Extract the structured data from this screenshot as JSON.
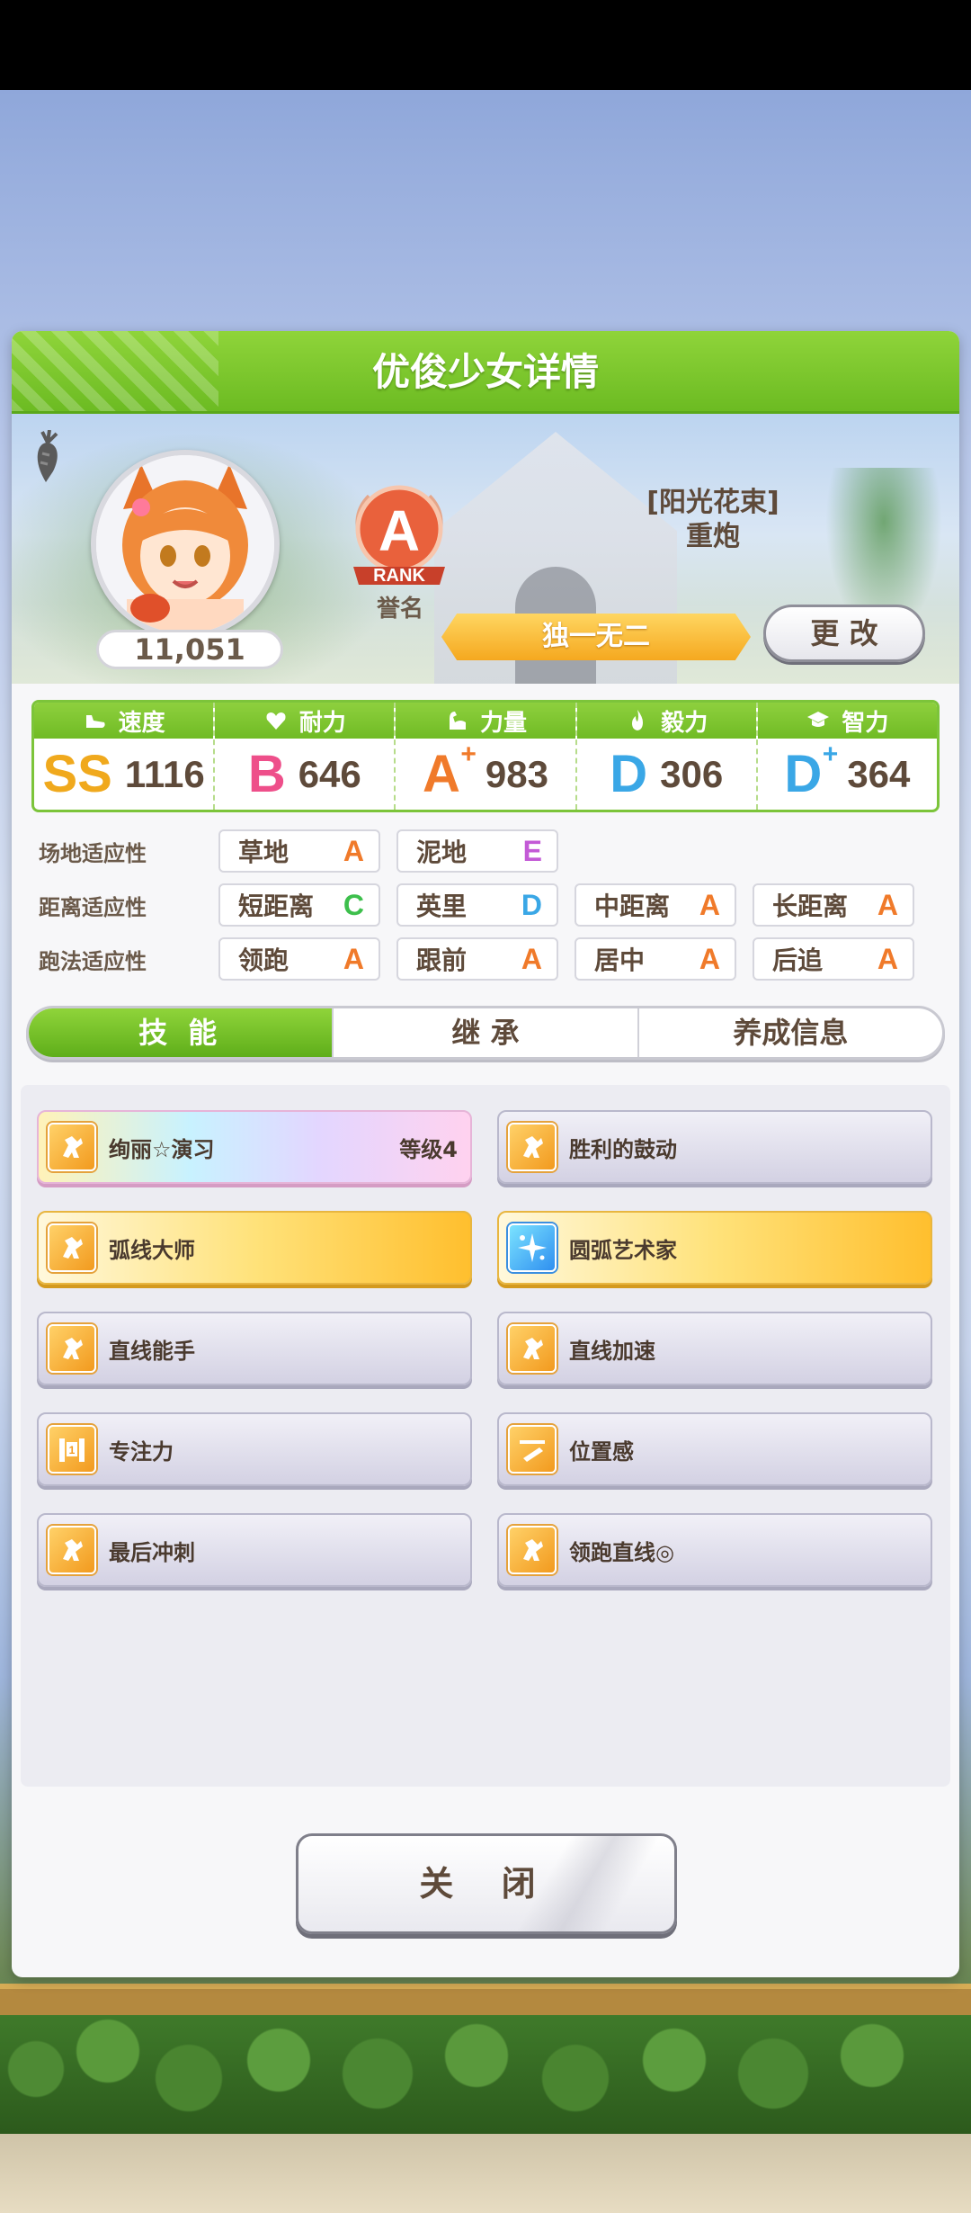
{
  "dialog": {
    "title": "优俊少女详情",
    "close_label": "关 闭"
  },
  "profile": {
    "fan_count": "11,051",
    "rank_grade": "A",
    "rank_word": "RANK",
    "rank_title": "誉名",
    "epithet_line1": "[阳光花束]",
    "epithet_line2": "重炮",
    "unique_banner": "独一无二",
    "change_label": "更 改"
  },
  "stats": [
    {
      "label": "速度",
      "icon": "shoe-icon",
      "grade": "SS",
      "plus": "",
      "value": "1116",
      "color": "#f0a91d"
    },
    {
      "label": "耐力",
      "icon": "heart-icon",
      "grade": "B",
      "plus": "",
      "value": "646",
      "color": "#ee4f8a"
    },
    {
      "label": "力量",
      "icon": "arm-icon",
      "grade": "A",
      "plus": "+",
      "value": "983",
      "color": "#f07a2a"
    },
    {
      "label": "毅力",
      "icon": "flame-icon",
      "grade": "D",
      "plus": "",
      "value": "306",
      "color": "#3aa7e6"
    },
    {
      "label": "智力",
      "icon": "mortarboard-icon",
      "grade": "D",
      "plus": "+",
      "value": "364",
      "color": "#3aa7e6"
    }
  ],
  "aptitude": {
    "track_label": "场地适应性",
    "track": [
      {
        "name": "草地",
        "grade": "A",
        "color": "#f07a2a"
      },
      {
        "name": "泥地",
        "grade": "E",
        "color": "#c35ad6"
      }
    ],
    "distance_label": "距离适应性",
    "distance": [
      {
        "name": "短距离",
        "grade": "C",
        "color": "#3dbf4c"
      },
      {
        "name": "英里",
        "grade": "D",
        "color": "#3aa7e6"
      },
      {
        "name": "中距离",
        "grade": "A",
        "color": "#f07a2a"
      },
      {
        "name": "长距离",
        "grade": "A",
        "color": "#f07a2a"
      }
    ],
    "style_label": "跑法适应性",
    "style": [
      {
        "name": "领跑",
        "grade": "A",
        "color": "#f07a2a"
      },
      {
        "name": "跟前",
        "grade": "A",
        "color": "#f07a2a"
      },
      {
        "name": "居中",
        "grade": "A",
        "color": "#f07a2a"
      },
      {
        "name": "后追",
        "grade": "A",
        "color": "#f07a2a"
      }
    ]
  },
  "tabs": [
    "技 能",
    "继 承",
    "养成信息"
  ],
  "skills": [
    {
      "name": "绚丽☆演习",
      "level": "等级4",
      "style": "rainbow",
      "icon": "running-horse-icon"
    },
    {
      "name": "胜利的鼓动",
      "level": "",
      "style": "normal",
      "icon": "running-horse-icon"
    },
    {
      "name": "弧线大师",
      "level": "",
      "style": "gold",
      "icon": "running-horse-icon"
    },
    {
      "name": "圆弧艺术家",
      "level": "",
      "style": "gold",
      "icon": "sparkle-icon"
    },
    {
      "name": "直线能手",
      "level": "",
      "style": "normal",
      "icon": "running-horse-icon"
    },
    {
      "name": "直线加速",
      "level": "",
      "style": "normal",
      "icon": "running-horse-icon"
    },
    {
      "name": "专注力",
      "level": "",
      "style": "normal",
      "icon": "starting-gate-icon"
    },
    {
      "name": "位置感",
      "level": "",
      "style": "normal",
      "icon": "position-icon"
    },
    {
      "name": "最后冲刺",
      "level": "",
      "style": "normal",
      "icon": "running-horse-icon"
    },
    {
      "name": "领跑直线◎",
      "level": "",
      "style": "normal",
      "icon": "running-horse-icon"
    }
  ]
}
